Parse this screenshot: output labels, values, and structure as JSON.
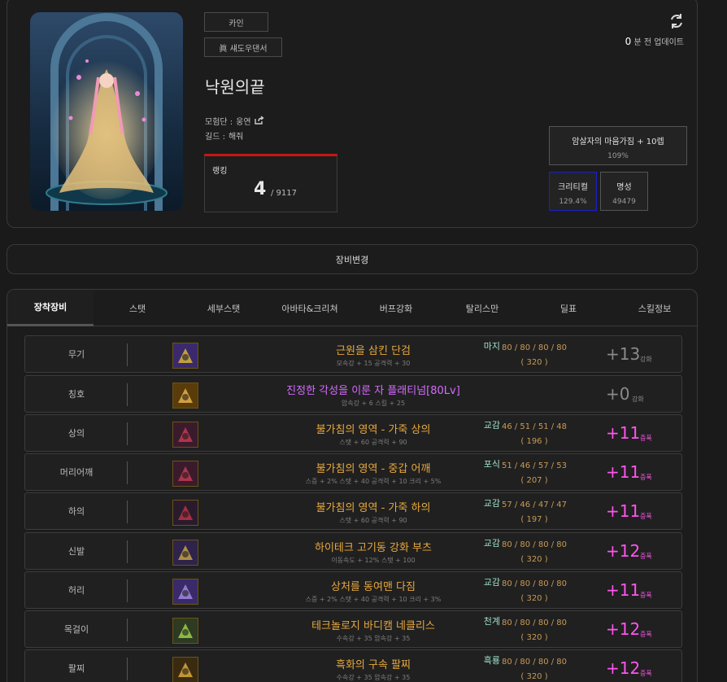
{
  "profile": {
    "server": "카인",
    "job": "眞 섀도우댄서",
    "name": "낙원의끝",
    "adventure_label": "모험단 : ",
    "adventure": "웅연",
    "guild_label": "길드 : ",
    "guild": "해줘",
    "rank_label": "랭킹",
    "rank_value": "4",
    "rank_total": "/ 9117",
    "updated_num": "0",
    "updated_text": "분 전 업데이트",
    "buff_title": "암살자의 마음가짐 + 10렙",
    "buff_value": "109%",
    "crit_label": "크리티컬",
    "crit_value": "129.4%",
    "fame_label": "명성",
    "fame_value": "49479"
  },
  "equip_change_label": "장비변경",
  "tabs": [
    "장착장비",
    "스탯",
    "세부스탯",
    "아바타&크리쳐",
    "버프강화",
    "탈리스만",
    "딜표",
    "스킬정보"
  ],
  "equipment": [
    {
      "slot": "무기",
      "name": "근원을 삼킨 단검",
      "opts": "모속강 + 15 공격력 + 30",
      "grade": "마지",
      "values": "80 / 80 / 80 / 80",
      "sum": "( 320 )",
      "enchant": "+13",
      "enchant_label": "강화",
      "rarity": "legend",
      "ench_style": "gray"
    },
    {
      "slot": "칭호",
      "name": "진정한 각성을 이룬 자 플래티넘[80Lv]",
      "opts": "암속강 + 6 스킬 + 25",
      "grade": "",
      "values": "",
      "sum": "",
      "enchant": "+0",
      "enchant_label": "강화",
      "rarity": "epic",
      "ench_style": "gray"
    },
    {
      "slot": "상의",
      "name": "불가침의 영역 - 가죽 상의",
      "opts": "스탯 + 60 공격력 + 90",
      "grade": "교감",
      "values": "46 / 51 / 51 / 48",
      "sum": "( 196 )",
      "enchant": "+11",
      "enchant_label": "증폭",
      "rarity": "legend",
      "ench_style": "pink"
    },
    {
      "slot": "머리어깨",
      "name": "불가침의 영역 - 중갑 어깨",
      "opts": "스증 + 2% 스탯 + 40 공격력 + 10 크리 + 5%",
      "grade": "포식",
      "values": "51 / 46 / 57 / 53",
      "sum": "( 207 )",
      "enchant": "+11",
      "enchant_label": "증폭",
      "rarity": "legend",
      "ench_style": "pink"
    },
    {
      "slot": "하의",
      "name": "불가침의 영역 - 가죽 하의",
      "opts": "스탯 + 60 공격력 + 90",
      "grade": "교감",
      "values": "57 / 46 / 47 / 47",
      "sum": "( 197 )",
      "enchant": "+11",
      "enchant_label": "증폭",
      "rarity": "legend",
      "ench_style": "pink"
    },
    {
      "slot": "신발",
      "name": "하이테크 고기동 강화 부츠",
      "opts": "이동속도 + 12% 스탯 + 100",
      "grade": "교감",
      "values": "80 / 80 / 80 / 80",
      "sum": "( 320 )",
      "enchant": "+12",
      "enchant_label": "증폭",
      "rarity": "legend",
      "ench_style": "pink"
    },
    {
      "slot": "허리",
      "name": "상처를 동여맨 다짐",
      "opts": "스증 + 2% 스탯 + 40 공격력 + 10 크리 + 3%",
      "grade": "교감",
      "values": "80 / 80 / 80 / 80",
      "sum": "( 320 )",
      "enchant": "+11",
      "enchant_label": "증폭",
      "rarity": "legend",
      "ench_style": "pink"
    },
    {
      "slot": "목걸이",
      "name": "테크놀로지 바디캠 네클리스",
      "opts": "수속강 + 35 암속강 + 35",
      "grade": "천계",
      "values": "80 / 80 / 80 / 80",
      "sum": "( 320 )",
      "enchant": "+12",
      "enchant_label": "증폭",
      "rarity": "legend",
      "ench_style": "pink"
    },
    {
      "slot": "팔찌",
      "name": "흑화의 구속 팔찌",
      "opts": "수속강 + 35 암속강 + 35",
      "grade": "흑룡",
      "values": "80 / 80 / 80 / 80",
      "sum": "( 320 )",
      "enchant": "+12",
      "enchant_label": "증폭",
      "rarity": "legend",
      "ench_style": "pink"
    }
  ],
  "icons": [
    "weapon-icon",
    "title-icon",
    "top-icon",
    "shoulder-icon",
    "bottom-icon",
    "shoes-icon",
    "belt-icon",
    "necklace-icon",
    "bracelet-icon"
  ],
  "colors": {
    "legend": "#e7a83d",
    "epic": "#d66bff",
    "enchant_pink": "#ff55ee",
    "rank_bar": "#c91414",
    "crit_border": "#1b21c9"
  }
}
